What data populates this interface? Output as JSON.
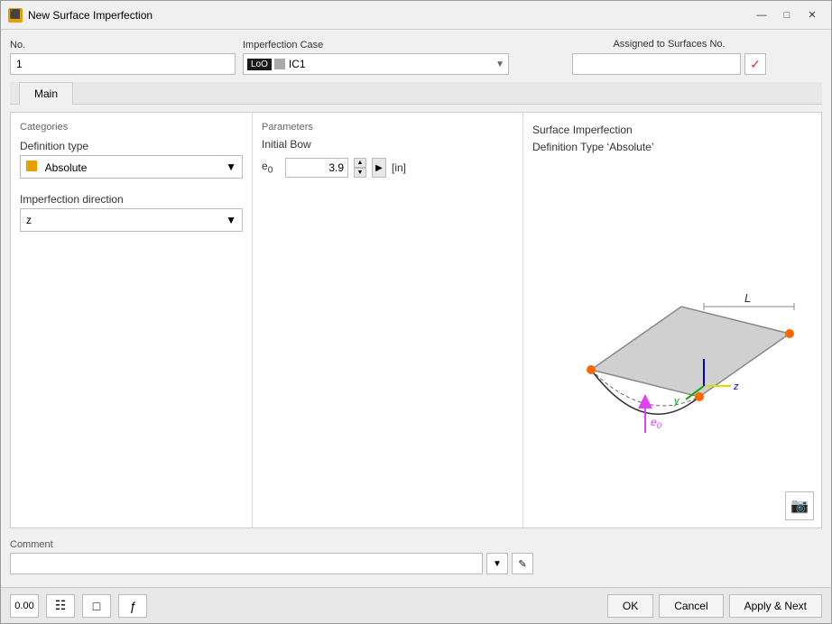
{
  "window": {
    "title": "New Surface Imperfection",
    "icon": "⬛"
  },
  "header": {
    "no_label": "No.",
    "no_value": "1",
    "imperfection_case_label": "Imperfection Case",
    "imperfection_case_badge": "LoO",
    "imperfection_case_value": "IC1",
    "assigned_label": "Assigned to Surfaces No.",
    "assigned_value": ""
  },
  "tabs": [
    {
      "id": "main",
      "label": "Main",
      "active": true
    }
  ],
  "categories": {
    "title": "Categories",
    "definition_type_label": "Definition type",
    "definition_type_value": "Absolute",
    "definition_type_color": "#e8a000",
    "imperfection_direction_label": "Imperfection direction",
    "imperfection_direction_value": "z"
  },
  "parameters": {
    "title": "Parameters",
    "initial_bow_label": "Initial Bow",
    "e0_label": "e₀",
    "e0_value": "3.9",
    "e0_unit": "[in]"
  },
  "description": {
    "line1": "Surface Imperfection",
    "line2": "Definition Type ‘Absolute’"
  },
  "comment": {
    "label": "Comment",
    "placeholder": "",
    "value": ""
  },
  "footer": {
    "ok_label": "OK",
    "cancel_label": "Cancel",
    "apply_next_label": "Apply & Next"
  },
  "toolbar": {
    "btn1": "0.00",
    "btn2": "📐",
    "btn3": "👁",
    "btn4": "ƒ"
  }
}
